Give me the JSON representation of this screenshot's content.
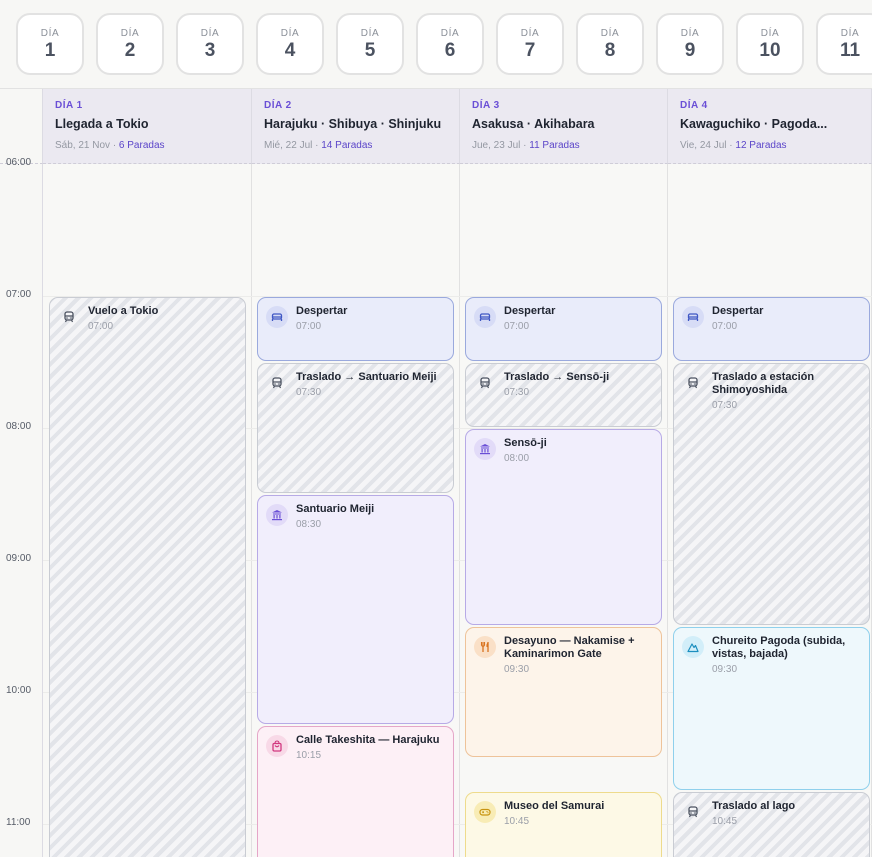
{
  "days": [
    {
      "label": "DÍA",
      "num": "1"
    },
    {
      "label": "DÍA",
      "num": "2"
    },
    {
      "label": "DÍA",
      "num": "3"
    },
    {
      "label": "DÍA",
      "num": "4"
    },
    {
      "label": "DÍA",
      "num": "5"
    },
    {
      "label": "DÍA",
      "num": "6"
    },
    {
      "label": "DÍA",
      "num": "7"
    },
    {
      "label": "DÍA",
      "num": "8"
    },
    {
      "label": "DÍA",
      "num": "9"
    },
    {
      "label": "DÍA",
      "num": "10"
    },
    {
      "label": "DÍA",
      "num": "11"
    }
  ],
  "columns": [
    {
      "day_label": "DÍA 1",
      "title": "Llegada a Tokio",
      "date": "Sáb, 21 Nov · ",
      "stops": "6 Paradas"
    },
    {
      "day_label": "DÍA 2",
      "title": "Harajuku · Shibuya · Shinjuku",
      "date": "Mié, 22 Jul · ",
      "stops": "14 Paradas"
    },
    {
      "day_label": "DÍA 3",
      "title": "Asakusa · Akihabara",
      "date": "Jue, 23 Jul · ",
      "stops": "11 Paradas"
    },
    {
      "day_label": "DÍA 4",
      "title": "Kawaguchiko · Pagoda...",
      "date": "Vie, 24 Jul · ",
      "stops": "12 Paradas"
    }
  ],
  "time_labels": {
    "t0600": "06:00",
    "t0700": "07:00",
    "t0800": "08:00",
    "t0900": "09:00",
    "t1000": "10:00",
    "t1100": "11:00"
  },
  "events": {
    "c1_flight": {
      "name": "Vuelo a Tokio",
      "time": "07:00",
      "icon": "train-icon"
    },
    "c2_wake": {
      "name": "Despertar",
      "time": "07:00",
      "icon": "bed-icon"
    },
    "c2_transfer": {
      "name": "Traslado → Santuario Meiji",
      "time": "07:30",
      "icon": "train-icon"
    },
    "c2_meiji": {
      "name": "Santuario Meiji",
      "time": "08:30",
      "icon": "temple-icon"
    },
    "c2_takeshita": {
      "name": "Calle Takeshita — Harajuku",
      "time": "10:15",
      "icon": "shopping-bag-icon"
    },
    "c3_wake": {
      "name": "Despertar",
      "time": "07:00",
      "icon": "bed-icon"
    },
    "c3_transfer": {
      "name": "Traslado → Sensō-ji",
      "time": "07:30",
      "icon": "train-icon"
    },
    "c3_sensoji": {
      "name": "Sensō-ji",
      "time": "08:00",
      "icon": "temple-icon"
    },
    "c3_breakfast": {
      "name": "Desayuno — Nakamise + Kaminarimon Gate",
      "time": "09:30",
      "icon": "utensils-icon"
    },
    "c3_samurai": {
      "name": "Museo del Samurai",
      "time": "10:45",
      "icon": "gamepad-icon"
    },
    "c4_wake": {
      "name": "Despertar",
      "time": "07:00",
      "icon": "bed-icon"
    },
    "c4_transfer": {
      "name": "Traslado a estación Shimoyoshida",
      "time": "07:30",
      "icon": "train-icon"
    },
    "c4_chureito": {
      "name": "Chureito Pagoda (subida, vistas, bajada)",
      "time": "09:30",
      "icon": "mountain-icon"
    },
    "c4_lake": {
      "name": "Traslado al lago",
      "time": "10:45",
      "icon": "train-icon"
    }
  },
  "colors": {
    "accent": "#6a4fd6",
    "wake": "#e9ecfa",
    "visit": "#f1eefc",
    "shop": "#fdf0f6",
    "food": "#fdf4ea",
    "museum": "#fdf9e6",
    "nature": "#eef8fc"
  }
}
